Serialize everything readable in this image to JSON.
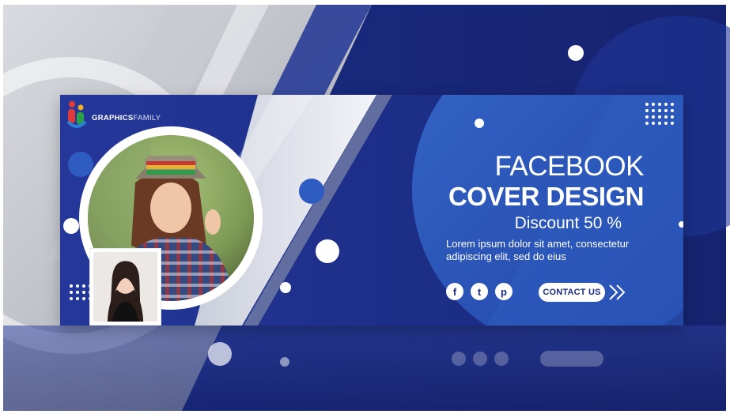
{
  "brand": {
    "name_bold": "GRAPHICS",
    "name_light": "FAMILY",
    "logo_icon": "people-logo-icon"
  },
  "headline": {
    "line1": "FACEBOOK",
    "line2": "COVER DESIGN",
    "discount": "Discount 50 %"
  },
  "description": "Lorem ipsum dolor sit amet, consectetur adipiscing elit, sed do eius",
  "social": [
    {
      "icon": "facebook-icon",
      "glyph": "f"
    },
    {
      "icon": "twitter-icon",
      "glyph": "t"
    },
    {
      "icon": "pinterest-icon",
      "glyph": "p"
    }
  ],
  "cta": {
    "label": "CONTACT US",
    "icon": "double-chevron-right-icon"
  },
  "colors": {
    "primary_blue": "#1c2e86",
    "deep_blue": "#142672",
    "light_blue": "#2c54b8",
    "white": "#ffffff",
    "photo_frame": "#ffffff",
    "background_gray": "#b9bcc4"
  }
}
